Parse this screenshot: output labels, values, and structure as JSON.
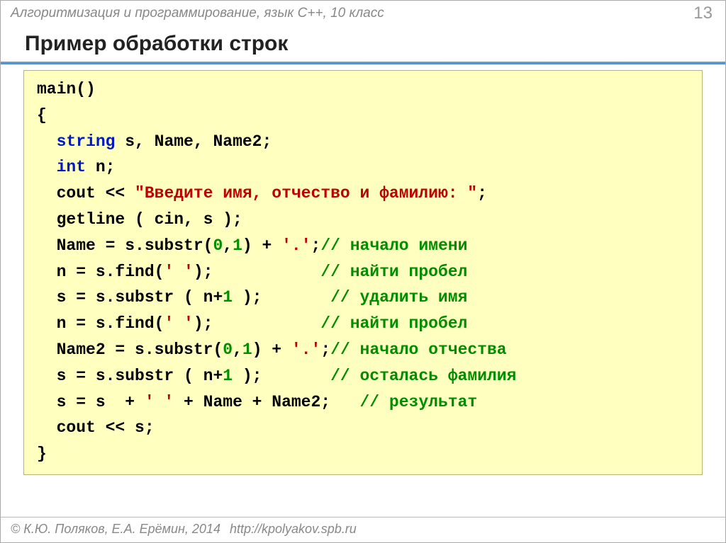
{
  "header": {
    "subject": "Алгоритмизация и программирование, язык C++, 10 класс",
    "page": "13"
  },
  "title": "Пример обработки строк",
  "code": {
    "l01_a": "main()",
    "l02_a": "{",
    "l03_a": "  ",
    "l03_kw": "string",
    "l03_b": " s, Name, Name2;",
    "l04_a": "  ",
    "l04_kw": "int",
    "l04_b": " n;",
    "l05_a": "  cout << ",
    "l05_str": "\"Введите имя, отчество и фамилию: \"",
    "l05_b": ";",
    "l06_a": "  getline ( cin, s );",
    "l07_a": "  Name = s.substr(",
    "l07_n1": "0",
    "l07_b": ",",
    "l07_n2": "1",
    "l07_c": ") + ",
    "l07_chr": "'.'",
    "l07_d": ";",
    "l07_cmt": "// начало имени",
    "l08_a": "  n = s.find(",
    "l08_chr": "' '",
    "l08_b": ");           ",
    "l08_cmt": "// найти пробел",
    "l09_a": "  s = s.substr ( n+",
    "l09_n": "1",
    "l09_b": " );       ",
    "l09_cmt": "// удалить имя",
    "l10_a": "  n = s.find(",
    "l10_chr": "' '",
    "l10_b": ");           ",
    "l10_cmt": "// найти пробел",
    "l11_a": "  Name2 = s.substr(",
    "l11_n1": "0",
    "l11_b": ",",
    "l11_n2": "1",
    "l11_c": ") + ",
    "l11_chr": "'.'",
    "l11_d": ";",
    "l11_cmt": "// начало отчества",
    "l12_a": "  s = s.substr ( n+",
    "l12_n": "1",
    "l12_b": " );       ",
    "l12_cmt": "// осталась фамилия",
    "l13_a": "  s = s  + ",
    "l13_chr1": "' '",
    "l13_b": " + Name + Name2;   ",
    "l13_cmt": "// результат",
    "l14_a": "  cout << s;",
    "l15_a": "}"
  },
  "footer": {
    "copyright": "© К.Ю. Поляков, Е.А. Ерёмин, 2014",
    "url": "http://kpolyakov.spb.ru"
  }
}
